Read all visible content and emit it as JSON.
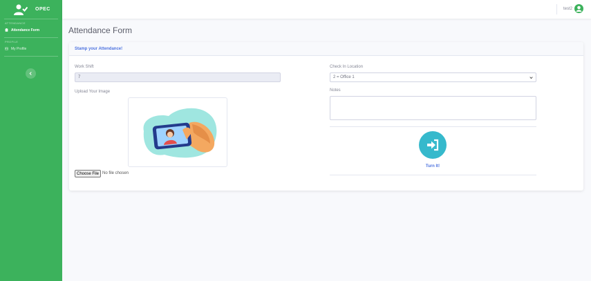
{
  "brand": {
    "name": "OPEC"
  },
  "sidebar": {
    "heading_attendance": "ATTENDANCE",
    "heading_profile": "PROFILE",
    "items": [
      {
        "label": "Attendance Form",
        "icon": "clipboard-icon",
        "active": true
      },
      {
        "label": "My Profile",
        "icon": "id-card-icon",
        "active": false
      }
    ]
  },
  "topbar": {
    "user_name": "test2"
  },
  "page": {
    "title": "Attendance Form"
  },
  "card": {
    "header": "Stamp your Attendance!",
    "work_shift": {
      "label": "Work Shift",
      "value": "7"
    },
    "upload": {
      "label": "Upload Your Image",
      "button": "Choose File",
      "status": "No file chosen"
    },
    "location": {
      "label": "Check In Location",
      "selected": "2 = Office 1"
    },
    "notes": {
      "label": "Notes",
      "value": ""
    },
    "submit": {
      "label": "Turn It!"
    }
  },
  "colors": {
    "sidebar": "#3cb25c",
    "primary": "#4e73df",
    "info": "#36b9cc",
    "background": "#f8f9fc"
  }
}
